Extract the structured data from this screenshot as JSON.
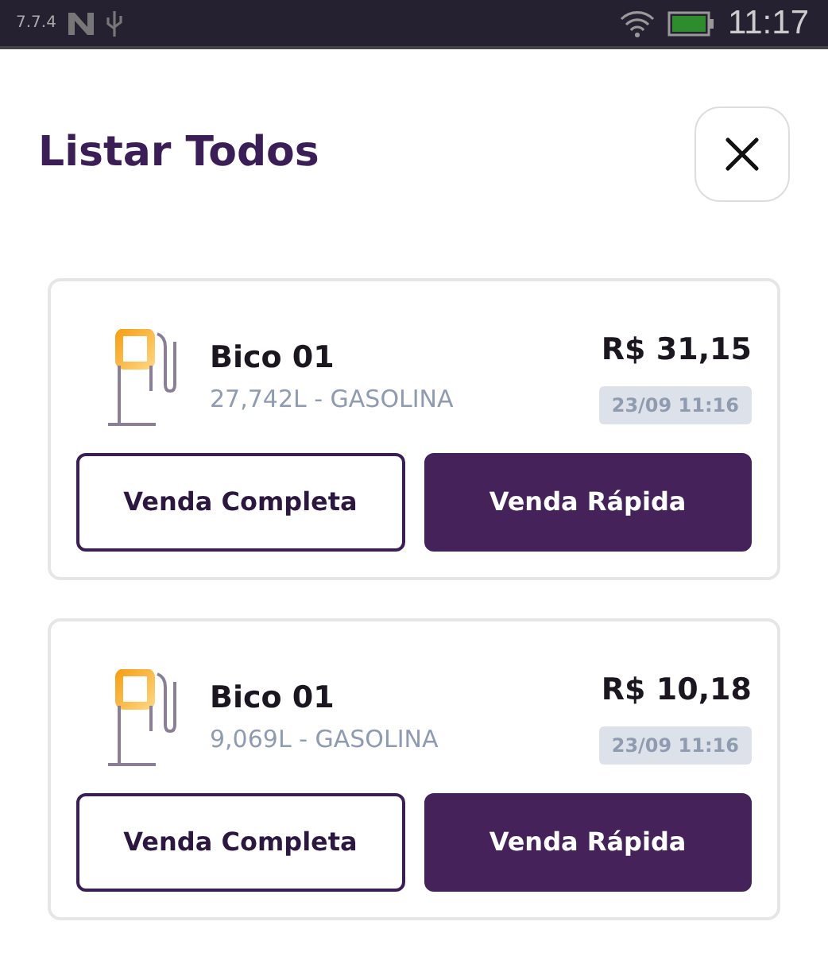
{
  "status_bar": {
    "version": "7.7.4",
    "time": "11:17"
  },
  "title": "Listar Todos",
  "items": [
    {
      "name": "Bico 01",
      "detail": "27,742L - GASOLINA",
      "price": "R$ 31,15",
      "date": "23/09 11:16",
      "buttons": [
        {
          "label": "Venda Completa",
          "kind": "outline"
        },
        {
          "label": "Venda Rápida",
          "kind": "filled"
        }
      ]
    },
    {
      "name": "Bico 01",
      "detail": "9,069L - GASOLINA",
      "price": "R$ 10,18",
      "date": "23/09 11:16",
      "buttons": [
        {
          "label": "Venda Completa",
          "kind": "outline"
        },
        {
          "label": "Venda Rápida",
          "kind": "filled"
        }
      ]
    }
  ]
}
